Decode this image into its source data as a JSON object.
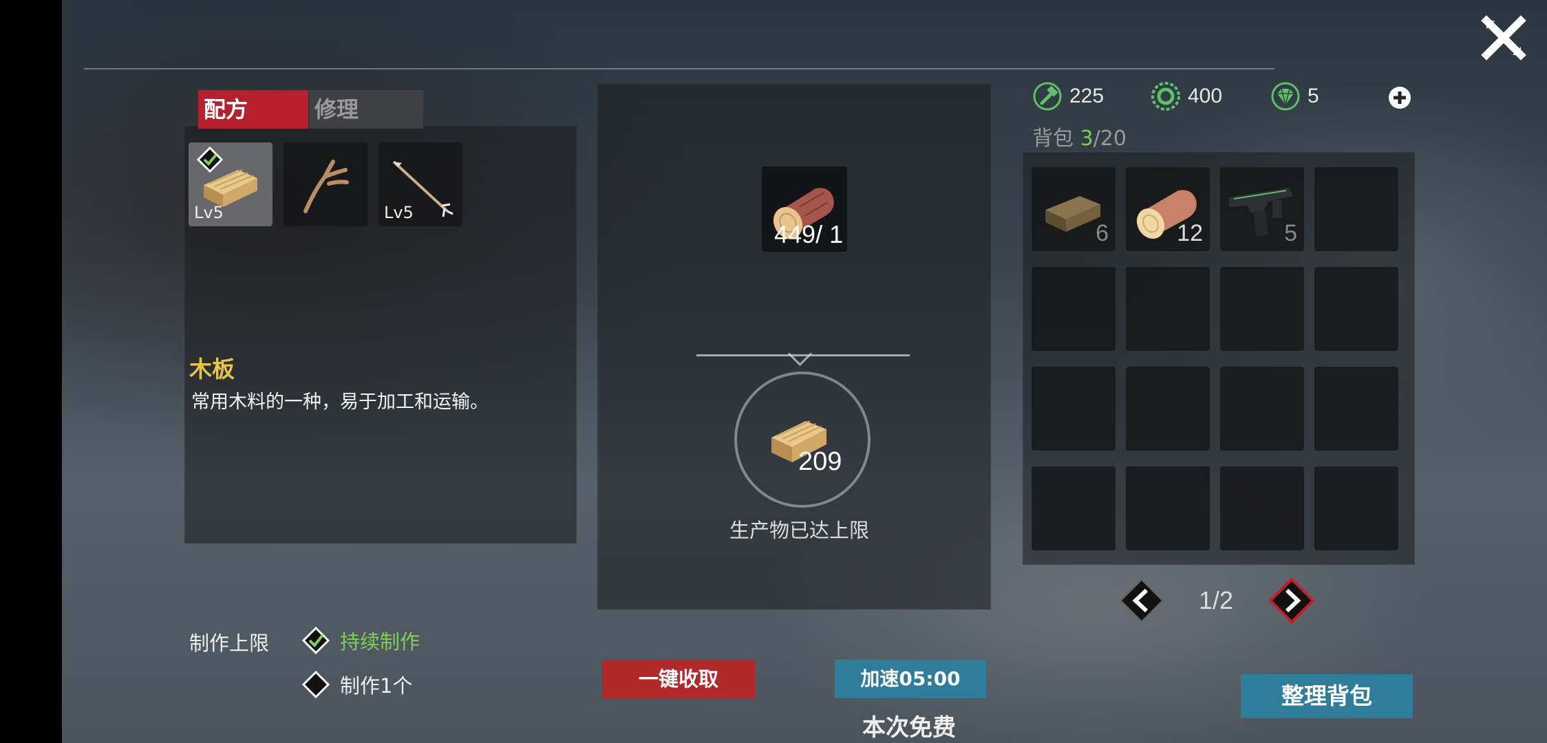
{
  "tabs": [
    {
      "label": "配方",
      "active": true
    },
    {
      "label": "修理",
      "active": false
    }
  ],
  "recipes": [
    {
      "icon": "wood-plank-icon",
      "level": "Lv5",
      "selected": true
    },
    {
      "icon": "branch-icon",
      "level": "",
      "selected": false
    },
    {
      "icon": "arrow-icon",
      "level": "Lv5",
      "selected": false
    }
  ],
  "item": {
    "name": "木板",
    "description": "常用木料的一种，易于加工和运输。"
  },
  "material": {
    "icon": "log-icon",
    "count": "449/ 1"
  },
  "product": {
    "icon": "wood-plank-icon",
    "count": "209",
    "status": "生产物已达上限"
  },
  "currencies": [
    {
      "icon": "hammer-icon",
      "value": "225"
    },
    {
      "icon": "gear-coin-icon",
      "value": "400"
    },
    {
      "icon": "diamond-icon",
      "value": "5"
    }
  ],
  "backpack": {
    "label": "背包",
    "current": "3",
    "capacity": "/20",
    "items": [
      {
        "icon": "wood-plank-icon",
        "count": "6"
      },
      {
        "icon": "log-icon",
        "count": "12"
      },
      {
        "icon": "gun-icon",
        "count": "5"
      }
    ],
    "page": "1/2"
  },
  "craft": {
    "limit_label": "制作上限",
    "option_continuous": "持续制作",
    "option_one": "制作1个",
    "selected": "continuous"
  },
  "buttons": {
    "collect_all": "一键收取",
    "speedup": "加速05:00",
    "free_note": "本次免费",
    "organize": "整理背包"
  },
  "colors": {
    "accent_red": "#b6202c",
    "accent_blue": "#2f7d9a",
    "title_yellow": "#e6c64a",
    "check_green": "#7ecf57"
  }
}
